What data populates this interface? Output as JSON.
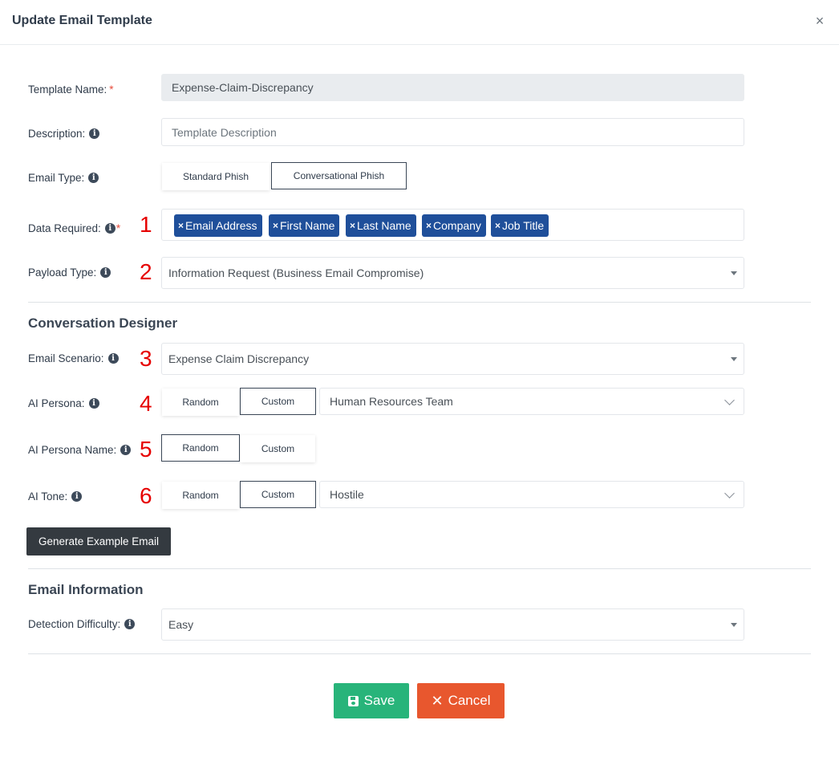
{
  "modal": {
    "title": "Update Email Template",
    "close_glyph": "×"
  },
  "form": {
    "template_name": {
      "label": "Template Name:",
      "required_mark": "*",
      "value": "Expense-Claim-Discrepancy"
    },
    "description": {
      "label": "Description:",
      "placeholder": "Template Description",
      "value": ""
    },
    "email_type": {
      "label": "Email Type:",
      "options": [
        "Standard Phish",
        "Conversational Phish"
      ],
      "selected": "Conversational Phish"
    },
    "data_required": {
      "label": "Data Required:",
      "required_mark": "*",
      "tags": [
        "Email Address",
        "First Name",
        "Last Name",
        "Company",
        "Job Title"
      ],
      "tag_remove_glyph": "×"
    },
    "payload_type": {
      "label": "Payload Type:",
      "value": "Information Request (Business Email Compromise)"
    }
  },
  "conversation_designer": {
    "title": "Conversation Designer",
    "email_scenario": {
      "label": "Email Scenario:",
      "value": "Expense Claim Discrepancy"
    },
    "ai_persona": {
      "label": "AI Persona:",
      "options": [
        "Random",
        "Custom"
      ],
      "selected": "Custom",
      "value": "Human Resources Team"
    },
    "ai_persona_name": {
      "label": "AI Persona Name:",
      "options": [
        "Random",
        "Custom"
      ],
      "selected": "Random"
    },
    "ai_tone": {
      "label": "AI Tone:",
      "options": [
        "Random",
        "Custom"
      ],
      "selected": "Custom",
      "value": "Hostile"
    },
    "generate_button": "Generate Example Email"
  },
  "email_information": {
    "title": "Email Information",
    "detection_difficulty": {
      "label": "Detection Difficulty:",
      "value": "Easy"
    }
  },
  "annotations": [
    "1",
    "2",
    "3",
    "4",
    "5",
    "6"
  ],
  "footer": {
    "save_label": "Save",
    "cancel_label": "Cancel",
    "cancel_glyph": "✕"
  },
  "colors": {
    "tag_bg": "#1f4f9a",
    "save_bg": "#28b47a",
    "cancel_bg": "#e8572e",
    "annotation": "#e60000",
    "dark_button": "#343a40"
  },
  "icons": {
    "info": "info-circle-icon",
    "save": "floppy-disk-icon",
    "cancel": "x-mark-icon",
    "close": "close-icon"
  }
}
